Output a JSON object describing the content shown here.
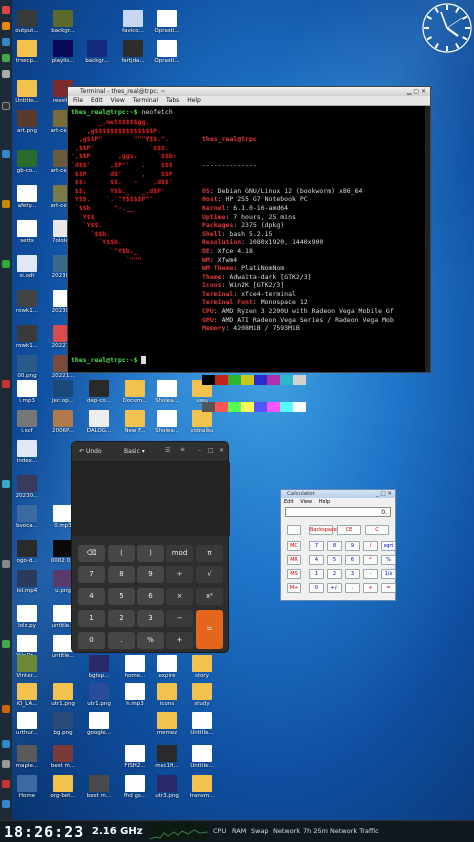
{
  "desktop_icons": [
    {
      "label": "output...",
      "color": "#3a3a3a"
    },
    {
      "label": "backgr...",
      "color": "#5b6a2a"
    },
    {
      "label": "favico...",
      "color": "#c9d8f0"
    },
    {
      "label": "Oprasti...",
      "color": "#ffffff"
    },
    {
      "label": "trsecp...",
      "color": "#f2c14e"
    },
    {
      "label": "playlis...",
      "color": "#0a0a5a"
    },
    {
      "label": "backgr...",
      "color": "#152a7a"
    },
    {
      "label": "fartjda...",
      "color": "#2d2d2d"
    },
    {
      "label": "Oprasti...",
      "color": "#ffffff"
    },
    {
      "label": "Untitle...",
      "color": "#f2c14e"
    },
    {
      "label": "ressit...",
      "color": "#7a2b2b"
    },
    {
      "label": "art.png",
      "color": "#5a3a2a"
    },
    {
      "label": "art-cen...",
      "color": "#7a6a3a"
    },
    {
      "label": "gb-co...",
      "color": "#2a6a2a"
    },
    {
      "label": "art-cen...",
      "color": "#6a5a3a"
    },
    {
      "label": "afety...",
      "color": "#ffffff"
    },
    {
      "label": "art-cen...",
      "color": "#7a7a4a"
    },
    {
      "label": "setts",
      "color": "#ffffff"
    },
    {
      "label": "7olole...",
      "color": "#e8e8e8"
    },
    {
      "label": "si.odt",
      "color": "#dfe8f5"
    },
    {
      "label": "20230...",
      "color": "#3a6a8a"
    },
    {
      "label": "rowk1...",
      "color": "#444444"
    },
    {
      "label": "20230...",
      "color": "#ffffff"
    },
    {
      "label": "rowk1...",
      "color": "#3a3a3a"
    },
    {
      "label": "20221...",
      "color": "#d84c4c"
    },
    {
      "label": "00.png",
      "color": "#2a5a8a"
    },
    {
      "label": "20221...",
      "color": "#7a4a3a"
    },
    {
      "label": "i.mp3",
      "color": "#ffffff"
    },
    {
      "label": "Jec.op...",
      "color": "#1a4a7a"
    },
    {
      "label": "dep-co...",
      "color": "#2a2a2a"
    },
    {
      "label": "Docum...",
      "color": "#f2c14e"
    },
    {
      "label": "Sholea...",
      "color": "#ffffff"
    },
    {
      "label": "uwu",
      "color": "#f2c14e"
    },
    {
      "label": "i.xcf",
      "color": "#777777"
    },
    {
      "label": "2006P...",
      "color": "#b07a4a"
    },
    {
      "label": "DALOG...",
      "color": "#eeeeee"
    },
    {
      "label": "New F...",
      "color": "#f2c14e"
    },
    {
      "label": "Sholea...",
      "color": "#ffffff"
    },
    {
      "label": "vidnaiku",
      "color": "#f2c14e"
    },
    {
      "label": "index...",
      "color": "#dfe8f5"
    },
    {
      "label": "20230...",
      "color": "#3a3a5a"
    },
    {
      "label": "bvoca...",
      "color": "#3a6aa0"
    },
    {
      "label": "0.mp3",
      "color": "#ffffff"
    },
    {
      "label": "ogo-d...",
      "color": "#2a2a2a"
    },
    {
      "label": "0002 0...",
      "color": "#0a0a0a"
    },
    {
      "label": "lol.mp4",
      "color": "#2a3a5a"
    },
    {
      "label": "u.png",
      "color": "#5a3a6a"
    },
    {
      "label": "lolz.py",
      "color": "#ffffff"
    },
    {
      "label": "untitle...",
      "color": "#ffffff"
    },
    {
      "label": "WinDr...",
      "color": "#ffffff"
    },
    {
      "label": "untitle...",
      "color": "#ffffff"
    },
    {
      "label": "Vinter...",
      "color": "#6a8a3a"
    },
    {
      "label": "bgtsp...",
      "color": "#2a2a6a"
    },
    {
      "label": "home...",
      "color": "#ffffff"
    },
    {
      "label": "expire",
      "color": "#ffffff"
    },
    {
      "label": "story",
      "color": "#f2c14e"
    },
    {
      "label": "iO_LA...",
      "color": "#f2c14e"
    },
    {
      "label": "utr1.png",
      "color": "#f2c14e"
    },
    {
      "label": "utr1.png",
      "color": "#2a4a9a"
    },
    {
      "label": "h.mp3",
      "color": "#ffffff"
    },
    {
      "label": "icons",
      "color": "#f2c14e"
    },
    {
      "label": "study",
      "color": "#f2c14e"
    },
    {
      "label": "urthur...",
      "color": "#ffffff"
    },
    {
      "label": "bg.png",
      "color": "#2a4a7a"
    },
    {
      "label": "google...",
      "color": "#ffffff"
    },
    {
      "label": "memez",
      "color": "#f2c14e"
    },
    {
      "label": "Untitle...",
      "color": "#ffffff"
    },
    {
      "label": "maple...",
      "color": "#5a5a5a"
    },
    {
      "label": "best m...",
      "color": "#7a3a3a"
    },
    {
      "label": "FISH2...",
      "color": "#ffffff"
    },
    {
      "label": "msc1fi...",
      "color": "#2a2a2a"
    },
    {
      "label": "Untitle...",
      "color": "#ffffff"
    },
    {
      "label": "Home",
      "color": "#3a6aa0"
    },
    {
      "label": "org-bet...",
      "color": "#f2c14e"
    },
    {
      "label": "best m...",
      "color": "#4a4a4a"
    },
    {
      "label": "fhd gs...",
      "color": "#ffffff"
    },
    {
      "label": "utr3.png",
      "color": "#2a2a6a"
    },
    {
      "label": "transm...",
      "color": "#f2c14e"
    }
  ],
  "terminal": {
    "title": "Terminal - thes_real@trpc: ~",
    "menu": [
      "File",
      "Edit",
      "View",
      "Terminal",
      "Tabs",
      "Help"
    ],
    "prompt": "thes_real@trpc:~$",
    "command": "neofetch",
    "ascii": "       _,met$$$$$gg.\n    ,g$$$$$$$$$$$$$$$P.\n  ,g$$P\"        \"\"\"Y$$.\".\n ,$$P'              `$$$.\n',$$P       ,ggs.     `$$b:\n`d$$'     ,$P\"'   .    $$$\n $$P      d$'     ,    $$P\n $$:      $$.   -    ,d$$'\n $$;      Y$b._   _,d$P'\n Y$$.    `.`\"Y$$$$P\"'\n `$$b      \"-.__\n  `Y$$\n   `Y$$.\n     `$$b.\n       `Y$$b.\n          `\"Y$b._\n              `\"\"\"",
    "user_host": "thes_real@trpc",
    "separator": "--------------",
    "info": [
      {
        "key": "OS",
        "value": "Debian GNU/Linux 12 (bookworm) x86_64"
      },
      {
        "key": "Host",
        "value": "HP 255 G7 Notebook PC"
      },
      {
        "key": "Kernel",
        "value": "6.1.0-16-amd64"
      },
      {
        "key": "Uptime",
        "value": "7 hours, 25 mins"
      },
      {
        "key": "Packages",
        "value": "2375 (dpkg)"
      },
      {
        "key": "Shell",
        "value": "bash 5.2.15"
      },
      {
        "key": "Resolution",
        "value": "1080x1920, 1440x900"
      },
      {
        "key": "DE",
        "value": "Xfce 4.18"
      },
      {
        "key": "WM",
        "value": "Xfwm4"
      },
      {
        "key": "WM Theme",
        "value": "PlatiNomNom"
      },
      {
        "key": "Theme",
        "value": "Adwaita-dark [GTK2/3]"
      },
      {
        "key": "Icons",
        "value": "Win2K [GTK2/3]"
      },
      {
        "key": "Terminal",
        "value": "xfce4-terminal"
      },
      {
        "key": "Terminal Font",
        "value": "Monospace 12"
      },
      {
        "key": "CPU",
        "value": "AMD Ryzen 3 2200U with Radeon Vega Mobile Gf"
      },
      {
        "key": "GPU",
        "value": "AMD ATI Radeon Vega Series / Radeon Vega Mob"
      },
      {
        "key": "Memory",
        "value": "4208MiB / 7593MiB"
      }
    ],
    "palette": [
      "#000000",
      "#c4201c",
      "#2fb42f",
      "#c8c820",
      "#2b2bd0",
      "#b02fb0",
      "#2ab8c8",
      "#d0d0d0"
    ],
    "palette2": [
      "#555555",
      "#ff5555",
      "#55ff55",
      "#ffff55",
      "#5555ff",
      "#ff55ff",
      "#55ffff",
      "#ffffff"
    ],
    "prompt2": "thes_real@trpc:~$"
  },
  "gnome_calc": {
    "undo": "Undo",
    "mode": "Basic",
    "buttons": [
      "⌫",
      "(",
      ")",
      "mod",
      "π",
      "7",
      "8",
      "9",
      "÷",
      "√",
      "4",
      "5",
      "6",
      "×",
      "x²",
      "1",
      "2",
      "3",
      "−",
      "0",
      ".",
      "%",
      "+",
      "="
    ]
  },
  "win_calc": {
    "title": "Calculator",
    "menu": [
      "Edit",
      "View",
      "Help"
    ],
    "display": "0.",
    "top": [
      "Backspace",
      "CE",
      "C"
    ],
    "rows": [
      [
        "MC",
        "7",
        "8",
        "9",
        "/",
        "sqrt"
      ],
      [
        "MR",
        "4",
        "5",
        "6",
        "*",
        "%"
      ],
      [
        "MS",
        "1",
        "2",
        "3",
        "-",
        "1/x"
      ],
      [
        "M+",
        "0",
        "+/-",
        ".",
        "+",
        "="
      ]
    ]
  },
  "taskbar": {
    "clock": "18:26:23",
    "cpu_freq": "2.16 GHz",
    "cpu": "CPU",
    "ram": "RAM",
    "swap": "Swap",
    "network": "Network",
    "uptime": "7h 25m",
    "net_traffic": "Network Traffic"
  }
}
